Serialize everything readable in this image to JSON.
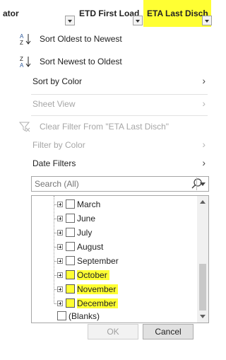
{
  "header": {
    "col1": "ator",
    "col2": "ETD First Load",
    "col3": "ETA Last Disch"
  },
  "menu": {
    "sort_asc": "Sort Oldest to Newest",
    "sort_desc": "Sort Newest to Oldest",
    "sort_by_color": "Sort by Color",
    "sheet_view": "Sheet View",
    "clear_filter": "Clear Filter From \"ETA Last Disch\"",
    "filter_by_color": "Filter by Color",
    "date_filters": "Date Filters"
  },
  "search": {
    "placeholder": "Search (All)"
  },
  "tree": {
    "items": [
      {
        "label": "March",
        "highlighted": false
      },
      {
        "label": "June",
        "highlighted": false
      },
      {
        "label": "July",
        "highlighted": false
      },
      {
        "label": "August",
        "highlighted": false
      },
      {
        "label": "September",
        "highlighted": false
      },
      {
        "label": "October",
        "highlighted": true
      },
      {
        "label": "November",
        "highlighted": true
      },
      {
        "label": "December",
        "highlighted": true
      }
    ],
    "blanks": "(Blanks)"
  },
  "buttons": {
    "ok": "OK",
    "cancel": "Cancel"
  },
  "colors": {
    "highlight": "#ffff33"
  }
}
